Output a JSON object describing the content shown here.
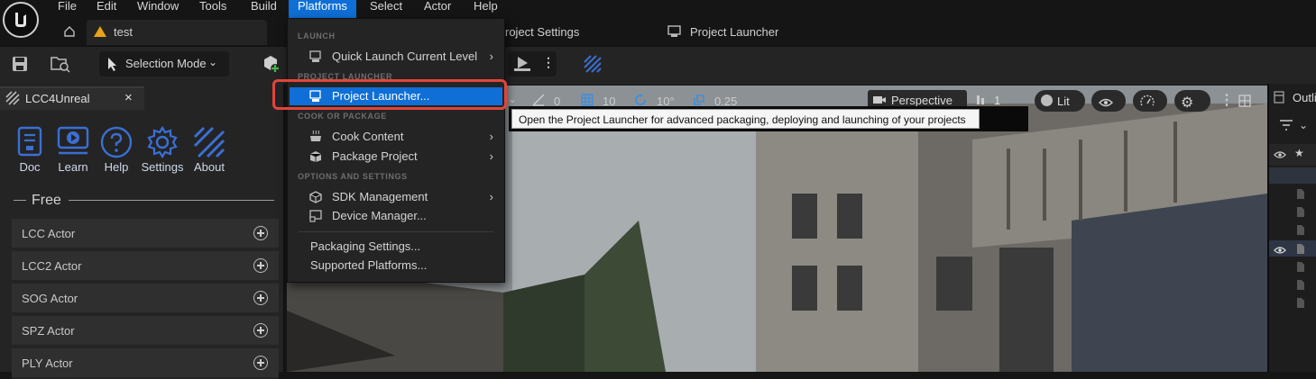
{
  "menubar": {
    "items": [
      "File",
      "Edit",
      "Window",
      "Tools",
      "Build",
      "Platforms",
      "Select",
      "Actor",
      "Help"
    ],
    "active": "Platforms"
  },
  "tabs": {
    "level_tab": "test",
    "settings_tab_partial": "roject Settings",
    "launcher_tab": "Project Launcher"
  },
  "toolbar": {
    "mode_label": "Selection Mode"
  },
  "viewport_toolbar": {
    "snap_angle_value": "0",
    "grid_size": "10",
    "rotation_snap": "10°",
    "scale_snap": "0.25",
    "view_mode": "Perspective",
    "lighting": "Lit",
    "camera_speed": "1"
  },
  "left_panel": {
    "tab_title": "LCC4Unreal",
    "buttons": [
      "Doc",
      "Learn",
      "Help",
      "Settings",
      "About"
    ],
    "section_title": "Free",
    "actors": [
      "LCC Actor",
      "LCC2 Actor",
      "SOG Actor",
      "SPZ Actor",
      "PLY Actor"
    ]
  },
  "right_panel": {
    "title_partial": "Outli"
  },
  "platforms_menu": {
    "sections": {
      "launch": "LAUNCH",
      "project_launcher": "PROJECT LAUNCHER",
      "cook_or_package": "COOK OR PACKAGE",
      "options_and_settings": "OPTIONS AND SETTINGS"
    },
    "items": {
      "quick_launch": "Quick Launch Current Level",
      "project_launcher": "Project Launcher...",
      "cook_content": "Cook Content",
      "package_project": "Package Project",
      "sdk_management": "SDK Management",
      "device_manager": "Device Manager...",
      "packaging_settings": "Packaging Settings...",
      "supported_platforms": "Supported Platforms..."
    }
  },
  "tooltip": "Open the Project Launcher for advanced packaging, deploying and launching of your projects",
  "colors": {
    "accent": "#0f6fd6",
    "highlight_box": "#e0453a",
    "plugin_icon": "#3b6fd4"
  }
}
